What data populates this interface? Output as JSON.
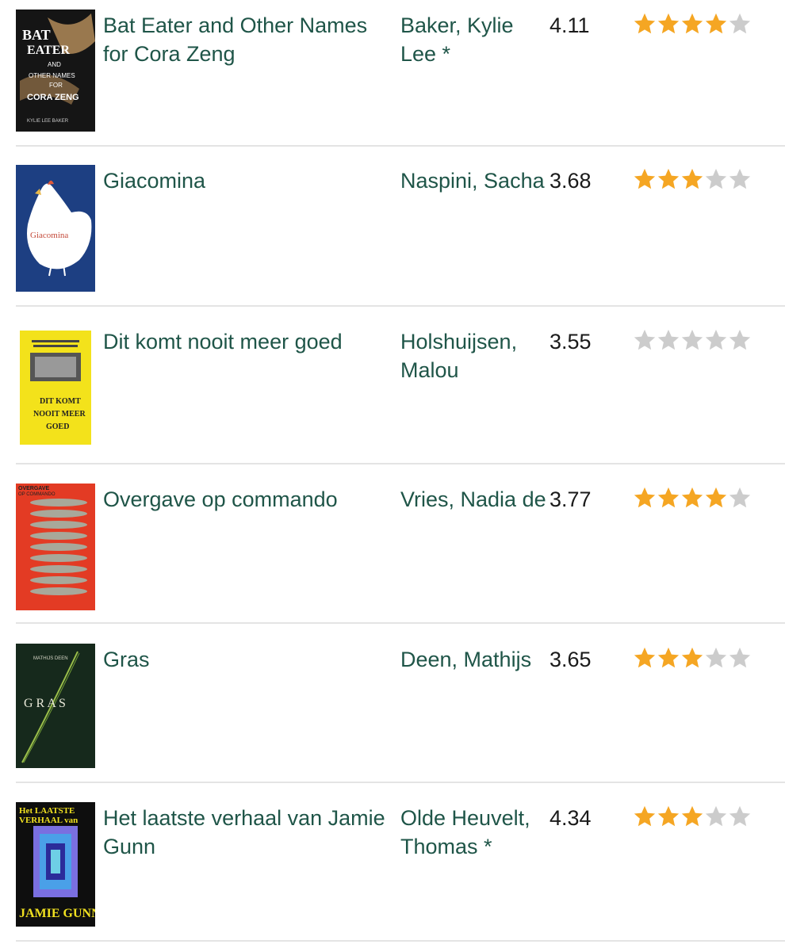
{
  "colors": {
    "link": "#1f5548",
    "star_on": "#f5a623",
    "star_off": "#cccccc",
    "divider": "#e4e4e4"
  },
  "books": [
    {
      "title": "Bat Eater and Other Names for Cora Zeng",
      "author": "Baker, Kylie Lee *",
      "avg_rating": "4.11",
      "user_stars": 4,
      "cover": {
        "lines": [
          "BAT",
          "EATER",
          "AND",
          "OTHER NAMES",
          "FOR",
          "CORA ZENG"
        ],
        "footer": "KYLIE LEE BAKER"
      }
    },
    {
      "title": "Giacomina",
      "author": "Naspini, Sacha",
      "avg_rating": "3.68",
      "user_stars": 3,
      "cover": {
        "lines": [
          "Giacomina"
        ]
      }
    },
    {
      "title": "Dit komt nooit meer goed",
      "author": "Holshuijsen, Malou",
      "avg_rating": "3.55",
      "user_stars": 0,
      "cover": {
        "lines": [
          "DIT KOMT",
          "NOOIT MEER",
          "GOED"
        ]
      }
    },
    {
      "title": "Overgave op commando",
      "author": "Vries, Nadia de",
      "avg_rating": "3.77",
      "user_stars": 4,
      "cover": {
        "lines": [
          "OVERGAVE",
          "OP COMMANDO"
        ]
      }
    },
    {
      "title": "Gras",
      "author": "Deen, Mathijs",
      "avg_rating": "3.65",
      "user_stars": 3,
      "cover": {
        "lines": [
          "MATHIJS DEEN",
          "G R A S"
        ]
      }
    },
    {
      "title": "Het laatste verhaal van Jamie Gunn",
      "author": "Olde Heuvelt, Thomas *",
      "avg_rating": "4.34",
      "user_stars": 3,
      "cover": {
        "lines": [
          "Het LAATSTE",
          "VERHAAL van",
          "JAMIE GUNN"
        ]
      }
    }
  ]
}
